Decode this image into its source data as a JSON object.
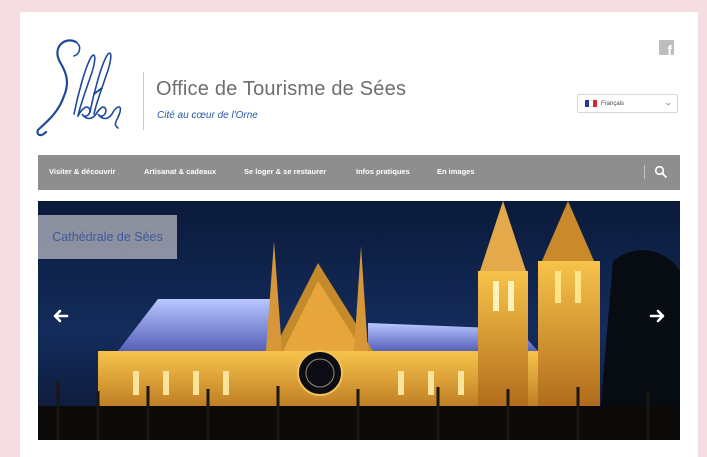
{
  "header": {
    "logo_text": "Sées",
    "title": "Office de Tourisme de Sées",
    "tagline": "Cité au cœur de l'Orne"
  },
  "social": {
    "facebook_label": "f"
  },
  "language": {
    "selected": "Français"
  },
  "nav": {
    "items": [
      {
        "label": "Visiter & découvrir"
      },
      {
        "label": "Artisanat & cadeaux"
      },
      {
        "label": "Se loger & se restaurer"
      },
      {
        "label": "Infos pratiques"
      },
      {
        "label": "En images"
      }
    ]
  },
  "slider": {
    "caption": "Cathédrale de Sées"
  },
  "colors": {
    "brand_blue": "#2a56a6",
    "nav_bg": "#8e8e8e",
    "page_border": "#f6dde2"
  }
}
